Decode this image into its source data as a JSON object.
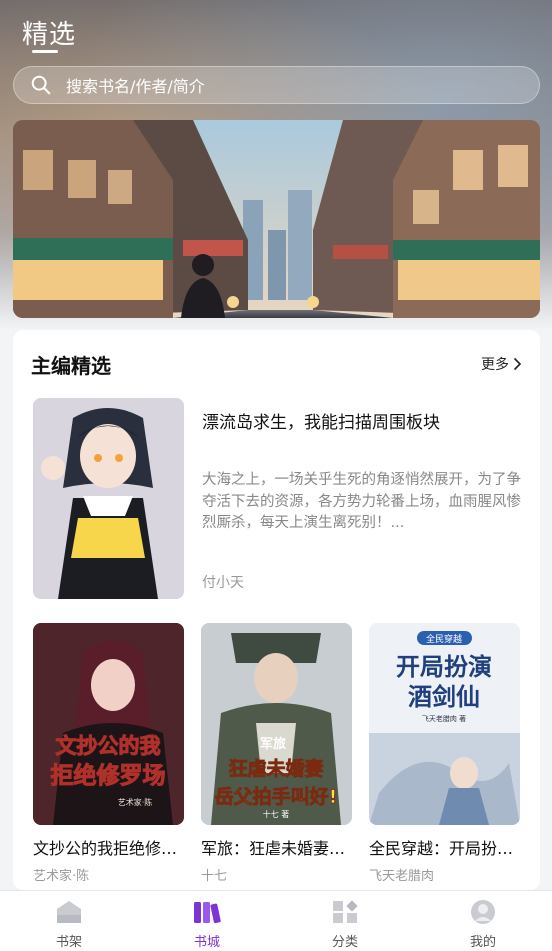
{
  "header": {
    "title": "精选",
    "search_placeholder": "搜索书名/作者/简介"
  },
  "section": {
    "title": "主编精选",
    "more_label": "更多"
  },
  "featured": {
    "title": "漂流岛求生，我能扫描周围板块",
    "description": "大海之上，一场关乎生死的角逐悄然展开，为了争夺活下去的资源，各方势力轮番上场，血雨腥风惨烈厮杀，每天上演生离死别！...",
    "author": "付小天"
  },
  "books": [
    {
      "title": "文抄公的我拒绝修罗场",
      "author": "艺术家·陈",
      "cover_text_1": "文抄公的我",
      "cover_text_2": "拒绝修罗场",
      "cover_text_3": "艺术家·陈"
    },
    {
      "title": "军旅：狂虐未婚妻，岳父拍手叫好!",
      "author": "十七",
      "cover_text_1": "军旅",
      "cover_text_2": "狂虐未婚妻",
      "cover_text_3": "岳父拍手叫好!",
      "cover_text_4": "十七 著"
    },
    {
      "title": "全民穿越：开局扮演酒剑仙",
      "author": "飞天老腊肉",
      "cover_text_1": "全民穿越",
      "cover_text_2": "开局扮演",
      "cover_text_3": "酒剑仙",
      "cover_text_4": "飞天老腊肉 著"
    }
  ],
  "tabs": [
    {
      "label": "书架",
      "icon": "bookshelf-icon"
    },
    {
      "label": "书城",
      "icon": "bookstore-icon",
      "active": true
    },
    {
      "label": "分类",
      "icon": "category-icon"
    },
    {
      "label": "我的",
      "icon": "profile-icon"
    }
  ],
  "colors": {
    "accent": "#7c35d4",
    "inactive_icon": "#c9cbd0"
  }
}
